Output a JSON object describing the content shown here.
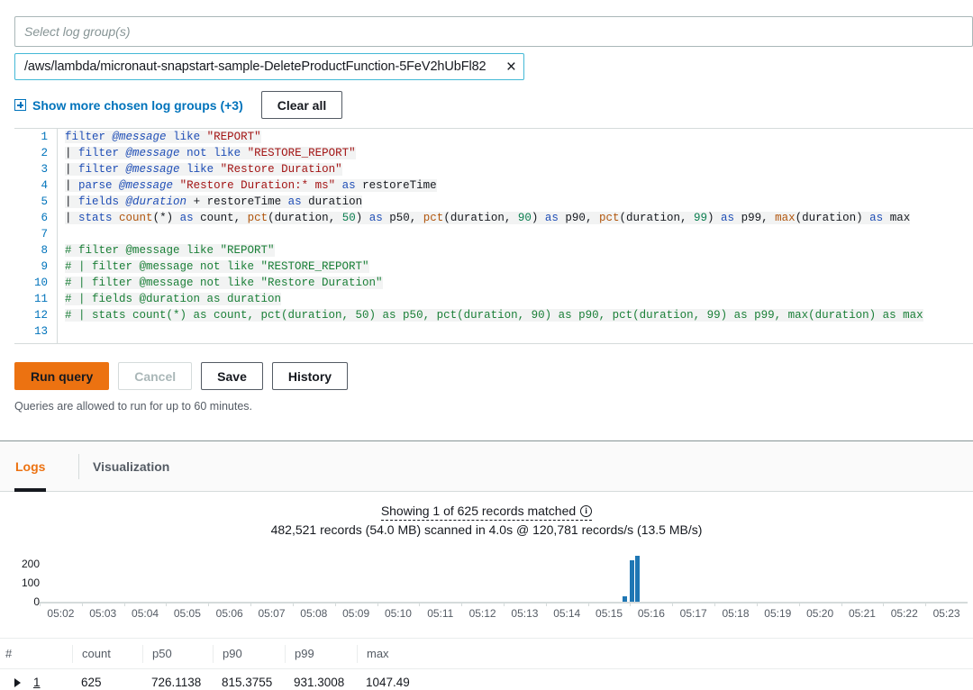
{
  "log_group_selector": {
    "placeholder": "Select log group(s)",
    "selected_token": "/aws/lambda/micronaut-snapstart-sample-DeleteProductFunction-5FeV2hUbFl82",
    "remove_icon": "×",
    "show_more_label": "Show more chosen log groups (+3)",
    "clear_all_label": "Clear all"
  },
  "query_editor": {
    "line_numbers": [
      "1",
      "2",
      "3",
      "4",
      "5",
      "6",
      "7",
      "8",
      "9",
      "10",
      "11",
      "12",
      "13"
    ],
    "lines": [
      "filter @message like \"REPORT\"",
      "| filter @message not like \"RESTORE_REPORT\"",
      "| filter @message like \"Restore Duration\"",
      "| parse @message \"Restore Duration:* ms\" as restoreTime",
      "| fields @duration + restoreTime as duration",
      "| stats count(*) as count, pct(duration, 50) as p50, pct(duration, 90) as p90, pct(duration, 99) as p99, max(duration) as max",
      "",
      "# filter @message like \"REPORT\"",
      "# | filter @message not like \"RESTORE_REPORT\"",
      "# | filter @message not like \"Restore Duration\"",
      "# | fields @duration as duration",
      "# | stats count(*) as count, pct(duration, 50) as p50, pct(duration, 90) as p90, pct(duration, 99) as p99, max(duration) as max",
      ""
    ]
  },
  "actions": {
    "run_label": "Run query",
    "cancel_label": "Cancel",
    "save_label": "Save",
    "history_label": "History",
    "hint": "Queries are allowed to run for up to 60 minutes."
  },
  "results": {
    "tabs": [
      {
        "label": "Logs",
        "active": true
      },
      {
        "label": "Visualization",
        "active": false
      }
    ],
    "showing_text": "Showing 1 of 625 records matched",
    "info_icon": "i",
    "scan_text": "482,521 records (54.0 MB) scanned in 4.0s @ 120,781 records/s (13.5 MB/s)",
    "columns": [
      "#",
      "count",
      "p50",
      "p90",
      "p99",
      "max"
    ],
    "rows": [
      {
        "index": "1",
        "count": "625",
        "p50": "726.1138",
        "p90": "815.3755",
        "p99": "931.3008",
        "max": "1047.49"
      }
    ]
  },
  "chart_data": {
    "type": "bar",
    "title": "",
    "xlabel": "",
    "ylabel": "",
    "ylim": [
      0,
      250
    ],
    "yticks": [
      "200",
      "100",
      "0"
    ],
    "ytick_values": [
      200,
      100,
      0
    ],
    "grid": false,
    "legend": null,
    "bar_color": "#1f77b4",
    "categories": [
      "05:02",
      "05:03",
      "05:04",
      "05:05",
      "05:06",
      "05:07",
      "05:08",
      "05:09",
      "05:10",
      "05:11",
      "05:12",
      "05:13",
      "05:14",
      "05:15",
      "05:16",
      "05:17",
      "05:18",
      "05:19",
      "05:20",
      "05:21",
      "05:22",
      "05:23"
    ],
    "bars": [
      {
        "x": "05:15:50",
        "value": 30
      },
      {
        "x": "05:16:00",
        "value": 220
      },
      {
        "x": "05:16:10",
        "value": 245
      }
    ],
    "note": "Counts of matched log events over time; activity concentrated at 05:16."
  },
  "colors": {
    "accent_orange": "#ec7211",
    "link_blue": "#0073bb",
    "bar_blue": "#1f77b4",
    "token_border": "#44b9d6"
  }
}
